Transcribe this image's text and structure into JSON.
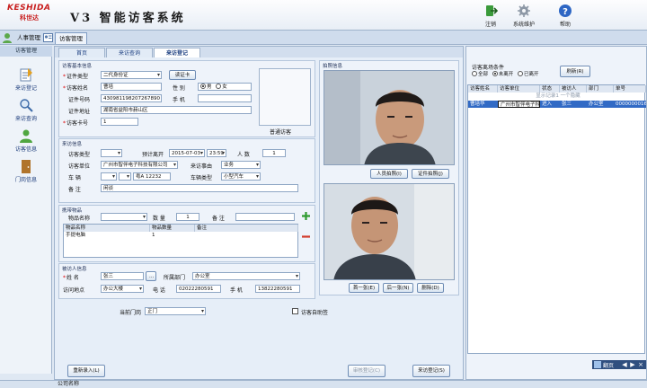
{
  "app": {
    "logo_text": "KESHIDA",
    "logo_cn": "科世达",
    "title": "V3 智能访客系统"
  },
  "header_buttons": [
    {
      "label": "注销",
      "icon": "logout-icon"
    },
    {
      "label": "系统维护",
      "icon": "gear-icon"
    },
    {
      "label": "帮助",
      "icon": "help-icon"
    }
  ],
  "top_tabs": [
    "人事管理",
    "访客管理"
  ],
  "sidebar": {
    "header": "访客管理",
    "items": [
      "来访登记",
      "来访查询",
      "访客信息",
      "门岗信息"
    ]
  },
  "subtabs": [
    "首页",
    "来访查询",
    "来访登记"
  ],
  "visitor_info": {
    "title": "访客基本信息",
    "id_type_label": "证件类型",
    "id_type_value": "二代身份证",
    "read_card_button": "读证卡",
    "name_label": "访客姓名",
    "name_value": "曹培",
    "gender_label": "性    别",
    "gender_options": [
      "男",
      "女"
    ],
    "gender_selected": "男",
    "id_no_label": "证件号码",
    "id_no_value": "430981198207267890",
    "phone_label": "手    机",
    "phone_value": "",
    "address_label": "证件地址",
    "address_value": "湖南省益阳市赫山区",
    "card_no_label": "访客卡号",
    "card_no_value": "1",
    "photo_caption": "普通访客"
  },
  "visit_info": {
    "title": "来访信息",
    "type_label": "访客类型",
    "type_value": "",
    "expected_leave_label": "预计离开",
    "expected_leave_date": "2015-07-03",
    "expected_leave_time": "23:59",
    "count_label": "人    数",
    "count_value": "1",
    "company_label": "访客单位",
    "company_value": "广州市智伴电子科技有限公司",
    "reason_label": "来访事由",
    "reason_value": "业务",
    "plate_label": "车    辆",
    "plate_value": "粤A 12232",
    "vehicle_type_label": "车辆类型",
    "vehicle_type_value": "小型汽车",
    "remark_label": "备    注",
    "remark_value": "闲谈"
  },
  "items": {
    "title": "携带物品",
    "name_label": "物品名称",
    "qty_label": "数    量",
    "qty_value": "1",
    "remark_label": "备    注",
    "columns": [
      "物品名称",
      "物品数量",
      "备注"
    ],
    "rows": [
      [
        "手提电脑",
        "1",
        ""
      ]
    ]
  },
  "host": {
    "title": "被访人信息",
    "name_label": "姓    名",
    "name_value": "张三",
    "dept_label": "所属部门",
    "dept_value": "办公室",
    "location_label": "访问地点",
    "location_value": "办公大楼",
    "tel_label": "电    话",
    "tel_value": "02022280591",
    "mobile_label": "手    机",
    "mobile_value": "13822280591"
  },
  "gate": {
    "label": "当前门岗",
    "value": "正门",
    "visitor_checkin_label": "访客自助签"
  },
  "photos": {
    "title": "拍照信息",
    "btn_person": "人员拍照(I)",
    "btn_cert": "证件拍照(J)",
    "btn_prev": "首一张(E)",
    "btn_next": "后一张(N)",
    "btn_delete": "删除(D)"
  },
  "footer_buttons": {
    "reset": "重新录入(L)",
    "approve": "审核登记(C)",
    "register": "来访登记(S)"
  },
  "right_panel": {
    "filter_title": "访客离场条件",
    "filter_options": [
      "全部",
      "未离开",
      "已离开"
    ],
    "filter_selected": "未离开",
    "refresh_button": "刷新(R)",
    "columns": [
      "访客姓名",
      "访客单位",
      "状态",
      "被访人",
      "部门",
      "单号"
    ],
    "group_caption": "显示记录1 一个隐藏",
    "rows": [
      [
        "曹培华",
        "广州市智伴电子科",
        "进入",
        "张三",
        "办公室",
        "0000000016"
      ]
    ],
    "footer_label": "翻页"
  },
  "status": {
    "text": "公司名称"
  },
  "colors": {
    "accent": "#316ac5",
    "brand": "#c81e1e",
    "panel": "#eef3fa"
  }
}
